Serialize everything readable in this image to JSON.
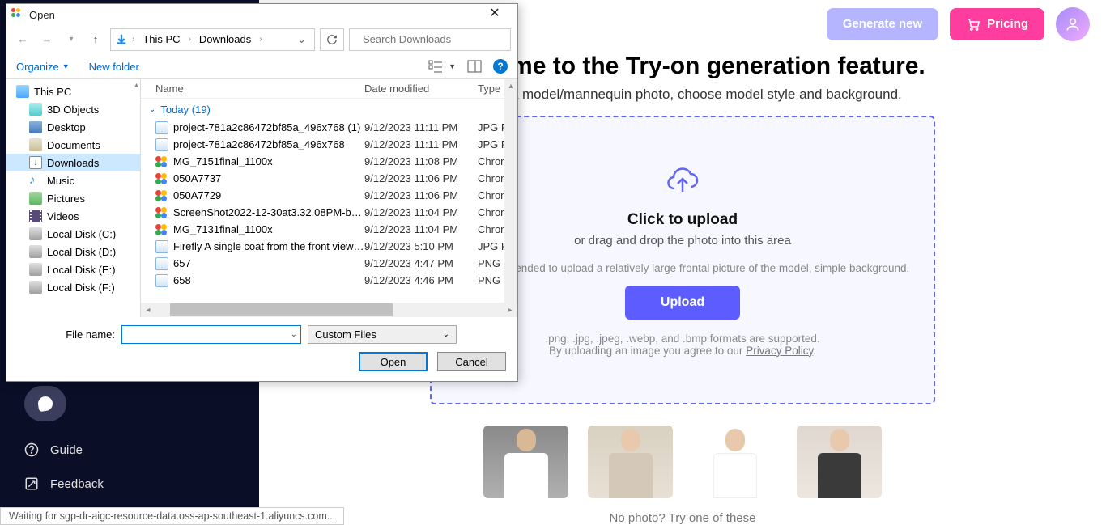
{
  "app": {
    "topbar": {
      "generate": "Generate new",
      "pricing": "Pricing"
    },
    "title": "Welcome to the Try-on generation feature.",
    "subtitle": "Upload a model/mannequin photo, choose model style and background.",
    "dropzone": {
      "title": "Click to upload",
      "sub": "or drag and drop the photo into this area",
      "note": "It is recommended to upload a relatively large frontal picture of the model, simple background.",
      "button": "Upload",
      "formats": ".png, .jpg, .jpeg, .webp, and .bmp formats are supported.",
      "agree_prefix": "By uploading an image you agree to our ",
      "privacy": "Privacy Policy",
      "agree_suffix": "."
    },
    "no_photo": "No photo? Try one of these",
    "sidebar": {
      "guide": "Guide",
      "feedback": "Feedback"
    }
  },
  "dialog": {
    "title": "Open",
    "breadcrumb": [
      "This PC",
      "Downloads"
    ],
    "search_placeholder": "Search Downloads",
    "toolbar": {
      "organize": "Organize",
      "new_folder": "New folder"
    },
    "columns": {
      "name": "Name",
      "date": "Date modified",
      "type": "Type"
    },
    "group_label": "Today (19)",
    "tree": [
      {
        "label": "This PC",
        "icon": "pc",
        "root": true
      },
      {
        "label": "3D Objects",
        "icon": "3d"
      },
      {
        "label": "Desktop",
        "icon": "desk"
      },
      {
        "label": "Documents",
        "icon": "doc"
      },
      {
        "label": "Downloads",
        "icon": "down",
        "selected": true
      },
      {
        "label": "Music",
        "icon": "music"
      },
      {
        "label": "Pictures",
        "icon": "pic"
      },
      {
        "label": "Videos",
        "icon": "vid"
      },
      {
        "label": "Local Disk (C:)",
        "icon": "disk"
      },
      {
        "label": "Local Disk (D:)",
        "icon": "disk"
      },
      {
        "label": "Local Disk (E:)",
        "icon": "disk"
      },
      {
        "label": "Local Disk (F:)",
        "icon": "disk"
      }
    ],
    "files": [
      {
        "icon": "img",
        "name": "project-781a2c86472bf85a_496x768 (1)",
        "date": "9/12/2023 11:11 PM",
        "type": "JPG F"
      },
      {
        "icon": "img",
        "name": "project-781a2c86472bf85a_496x768",
        "date": "9/12/2023 11:11 PM",
        "type": "JPG F"
      },
      {
        "icon": "chrome",
        "name": "MG_7151final_1100x",
        "date": "9/12/2023 11:08 PM",
        "type": "Chrom"
      },
      {
        "icon": "chrome",
        "name": "050A7737",
        "date": "9/12/2023 11:06 PM",
        "type": "Chrom"
      },
      {
        "icon": "chrome",
        "name": "050A7729",
        "date": "9/12/2023 11:06 PM",
        "type": "Chrom"
      },
      {
        "icon": "chrome",
        "name": "ScreenShot2022-12-30at3.32.08PM-b11e...",
        "date": "9/12/2023 11:04 PM",
        "type": "Chrom"
      },
      {
        "icon": "chrome",
        "name": "MG_7131final_1100x",
        "date": "9/12/2023 11:04 PM",
        "type": "Chrom"
      },
      {
        "icon": "img",
        "name": "Firefly A single coat from the front view 6...",
        "date": "9/12/2023 5:10 PM",
        "type": "JPG F"
      },
      {
        "icon": "img",
        "name": "657",
        "date": "9/12/2023 4:47 PM",
        "type": "PNG I"
      },
      {
        "icon": "img",
        "name": "658",
        "date": "9/12/2023 4:46 PM",
        "type": "PNG I"
      }
    ],
    "file_name_label": "File name:",
    "file_name_value": "",
    "filter": "Custom Files",
    "open": "Open",
    "cancel": "Cancel"
  },
  "status_bar": "Waiting for sgp-dr-aigc-resource-data.oss-ap-southeast-1.aliyuncs.com..."
}
